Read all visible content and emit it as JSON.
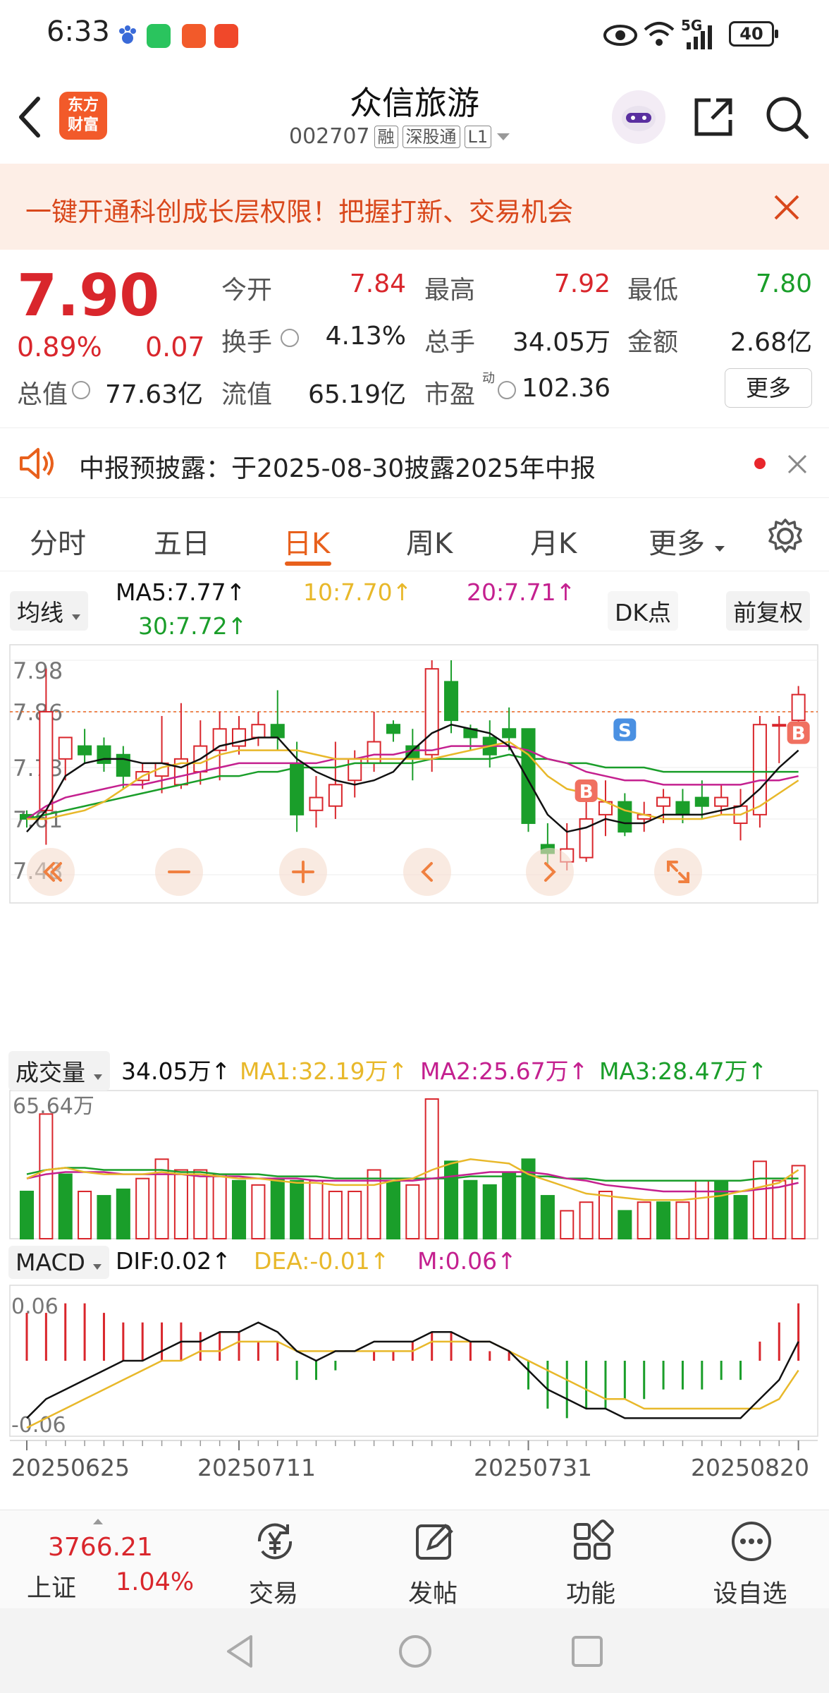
{
  "status_bar": {
    "time": "6:33",
    "network": "5G",
    "battery": "40",
    "icons": [
      "baidu-paw-icon",
      "wechat-icon",
      "app-icon",
      "send-icon",
      "eye-icon",
      "wifi-icon",
      "signal-icon",
      "battery-icon"
    ]
  },
  "header": {
    "brand": "东方财富",
    "title": "众信旅游",
    "code": "002707",
    "tags": [
      "融",
      "深股通",
      "L1"
    ],
    "icons": [
      "back-icon",
      "robot-avatar-icon",
      "share-icon",
      "search-icon"
    ]
  },
  "banner": {
    "text": "一键开通科创成长层权限！把握打新、交易机会",
    "color": "#d9481c"
  },
  "quote": {
    "price": "7.90",
    "change_pct": "0.89%",
    "change": "0.07",
    "rows": [
      [
        {
          "label": "今开",
          "value": "7.84",
          "color": "red"
        },
        {
          "label": "最高",
          "value": "7.92",
          "color": "red"
        },
        {
          "label": "最低",
          "value": "7.80",
          "color": "green"
        }
      ],
      [
        {
          "label": "换手",
          "value": "4.13%",
          "color": "black"
        },
        {
          "label": "总手",
          "value": "34.05万",
          "color": "black"
        },
        {
          "label": "金额",
          "value": "2.68亿",
          "color": "black"
        }
      ],
      [
        {
          "label": "流值",
          "value": "65.19亿",
          "color": "black"
        },
        {
          "label": "市盈",
          "value": "102.36",
          "color": "black"
        }
      ]
    ],
    "total_value_label": "总值",
    "total_value": "77.63亿",
    "pe_tag": "动",
    "more": "更多"
  },
  "notice": {
    "text": "中报预披露：于2025-08-30披露2025年中报",
    "icons": [
      "speaker-icon",
      "red-dot-icon",
      "close-icon"
    ]
  },
  "tabs": [
    "分时",
    "五日",
    "日K",
    "周K",
    "月K",
    "更多"
  ],
  "active_tab": "日K",
  "ma_legend": {
    "selector": "均线",
    "ma5": "MA5:7.77",
    "ma10": "10:7.70",
    "ma20": "20:7.71",
    "ma30": "30:7.72",
    "dk": "DK点",
    "adjust": "前复权"
  },
  "vol_legend": {
    "selector": "成交量",
    "vol": "34.05万",
    "ma1": "MA1:32.19万",
    "ma2": "MA2:25.67万",
    "ma3": "MA3:28.47万"
  },
  "macd_legend": {
    "selector": "MACD",
    "dif": "DIF:0.02",
    "dea": "DEA:-0.01",
    "m": "M:0.06"
  },
  "colors": {
    "up": "#d9262c",
    "down": "#1a9e2a",
    "ma5": "#111111",
    "ma10": "#e8b82a",
    "ma20": "#c4208f",
    "ma30": "#1a9e2a",
    "accent": "#e8601c"
  },
  "chart_data": [
    {
      "type": "candlestick",
      "title": "日K",
      "y_ticks": [
        "7.98",
        "7.86",
        "7.73",
        "7.61",
        "7.48"
      ],
      "ylim": [
        7.48,
        7.98
      ],
      "x_ticks": [
        "20250625",
        "20250711",
        "20250731",
        "20250820"
      ],
      "last_price_line": 7.86,
      "candles": [
        [
          7.62,
          7.61,
          7.63,
          7.59
        ],
        [
          7.63,
          7.86,
          7.96,
          7.55
        ],
        [
          7.75,
          7.8,
          7.8,
          7.7
        ],
        [
          7.78,
          7.76,
          7.82,
          7.74
        ],
        [
          7.78,
          7.74,
          7.8,
          7.72
        ],
        [
          7.76,
          7.71,
          7.78,
          7.68
        ],
        [
          7.7,
          7.72,
          7.74,
          7.68
        ],
        [
          7.71,
          7.74,
          7.85,
          7.67
        ],
        [
          7.69,
          7.75,
          7.88,
          7.68
        ],
        [
          7.72,
          7.78,
          7.84,
          7.69
        ],
        [
          7.77,
          7.82,
          7.86,
          7.7
        ],
        [
          7.78,
          7.82,
          7.85,
          7.76
        ],
        [
          7.8,
          7.83,
          7.86,
          7.78
        ],
        [
          7.83,
          7.8,
          7.91,
          7.77
        ],
        [
          7.74,
          7.62,
          7.79,
          7.58
        ],
        [
          7.63,
          7.66,
          7.71,
          7.59
        ],
        [
          7.64,
          7.69,
          7.79,
          7.61
        ],
        [
          7.7,
          7.75,
          7.77,
          7.66
        ],
        [
          7.74,
          7.79,
          7.86,
          7.72
        ],
        [
          7.83,
          7.81,
          7.84,
          7.79
        ],
        [
          7.78,
          7.75,
          7.82,
          7.7
        ],
        [
          7.76,
          7.96,
          7.98,
          7.72
        ],
        [
          7.93,
          7.84,
          7.98,
          7.81
        ],
        [
          7.82,
          7.8,
          7.83,
          7.77
        ],
        [
          7.8,
          7.76,
          7.84,
          7.73
        ],
        [
          7.82,
          7.8,
          7.87,
          7.77
        ],
        [
          7.82,
          7.6,
          7.82,
          7.58
        ],
        [
          7.55,
          7.53,
          7.6,
          7.5
        ],
        [
          7.51,
          7.54,
          7.6,
          7.49
        ],
        [
          7.52,
          7.61,
          7.65,
          7.51
        ],
        [
          7.62,
          7.65,
          7.7,
          7.57
        ],
        [
          7.65,
          7.58,
          7.67,
          7.57
        ],
        [
          7.61,
          7.62,
          7.65,
          7.58
        ],
        [
          7.64,
          7.66,
          7.68,
          7.6
        ],
        [
          7.65,
          7.62,
          7.68,
          7.6
        ],
        [
          7.66,
          7.64,
          7.7,
          7.61
        ],
        [
          7.64,
          7.66,
          7.69,
          7.62
        ],
        [
          7.6,
          7.64,
          7.68,
          7.56
        ],
        [
          7.62,
          7.83,
          7.85,
          7.59
        ],
        [
          7.83,
          7.83,
          7.85,
          7.74
        ],
        [
          7.84,
          7.9,
          7.92,
          7.8
        ]
      ],
      "ma5": [
        7.58,
        7.63,
        7.71,
        7.74,
        7.75,
        7.75,
        7.74,
        7.74,
        7.73,
        7.75,
        7.78,
        7.79,
        7.8,
        7.8,
        7.75,
        7.72,
        7.7,
        7.69,
        7.7,
        7.72,
        7.77,
        7.81,
        7.83,
        7.82,
        7.81,
        7.78,
        7.7,
        7.62,
        7.58,
        7.59,
        7.61,
        7.6,
        7.6,
        7.62,
        7.62,
        7.62,
        7.63,
        7.64,
        7.68,
        7.73,
        7.77
      ],
      "ma10": [
        7.61,
        7.61,
        7.62,
        7.63,
        7.65,
        7.68,
        7.71,
        7.73,
        7.74,
        7.74,
        7.76,
        7.77,
        7.77,
        7.77,
        7.77,
        7.76,
        7.75,
        7.75,
        7.75,
        7.75,
        7.75,
        7.75,
        7.76,
        7.77,
        7.78,
        7.79,
        7.76,
        7.71,
        7.68,
        7.67,
        7.65,
        7.63,
        7.62,
        7.61,
        7.61,
        7.61,
        7.62,
        7.62,
        7.64,
        7.67,
        7.7
      ],
      "ma20": [
        7.61,
        7.64,
        7.66,
        7.67,
        7.68,
        7.69,
        7.69,
        7.7,
        7.71,
        7.72,
        7.73,
        7.74,
        7.74,
        7.74,
        7.74,
        7.74,
        7.75,
        7.75,
        7.76,
        7.76,
        7.77,
        7.77,
        7.78,
        7.78,
        7.78,
        7.78,
        7.77,
        7.75,
        7.74,
        7.72,
        7.71,
        7.7,
        7.7,
        7.69,
        7.69,
        7.69,
        7.69,
        7.69,
        7.7,
        7.7,
        7.71
      ],
      "ma30": [
        7.61,
        7.62,
        7.63,
        7.64,
        7.65,
        7.66,
        7.67,
        7.68,
        7.69,
        7.7,
        7.71,
        7.71,
        7.72,
        7.72,
        7.73,
        7.73,
        7.73,
        7.74,
        7.74,
        7.74,
        7.74,
        7.75,
        7.75,
        7.75,
        7.75,
        7.76,
        7.75,
        7.75,
        7.74,
        7.74,
        7.73,
        7.73,
        7.73,
        7.72,
        7.72,
        7.72,
        7.72,
        7.72,
        7.72,
        7.72,
        7.72
      ],
      "markers": [
        {
          "label": "S",
          "index": 31
        },
        {
          "label": "B",
          "index": 29
        },
        {
          "label": "B",
          "index": 40
        }
      ]
    },
    {
      "type": "bar",
      "title": "成交量",
      "y_ticks": [
        "65.64万"
      ],
      "ylim": [
        0,
        65.64
      ],
      "values": [
        22,
        58,
        30,
        22,
        20,
        23,
        28,
        37,
        32,
        32,
        30,
        27,
        25,
        28,
        27,
        27,
        22,
        22,
        32,
        27,
        25,
        65,
        36,
        27,
        25,
        31,
        37,
        20,
        13,
        17,
        22,
        13,
        17,
        17,
        17,
        27,
        27,
        20,
        36,
        27,
        34
      ],
      "direction": [
        "d",
        "u",
        "d",
        "u",
        "d",
        "d",
        "u",
        "u",
        "u",
        "u",
        "u",
        "d",
        "u",
        "d",
        "d",
        "u",
        "u",
        "u",
        "u",
        "d",
        "u",
        "u",
        "d",
        "d",
        "d",
        "d",
        "d",
        "d",
        "u",
        "u",
        "u",
        "d",
        "u",
        "d",
        "u",
        "u",
        "d",
        "d",
        "u",
        "u",
        "u"
      ],
      "series": [
        {
          "name": "MA1",
          "values": [
            28,
            32,
            33,
            31,
            30,
            30,
            30,
            31,
            30,
            30,
            29,
            28,
            28,
            27,
            26,
            26,
            25,
            25,
            25,
            27,
            28,
            32,
            35,
            37,
            36,
            35,
            30,
            27,
            24,
            21,
            20,
            19,
            18,
            18,
            18,
            19,
            20,
            22,
            24,
            26,
            32
          ]
        },
        {
          "name": "MA2",
          "values": [
            28,
            30,
            31,
            31,
            31,
            30,
            30,
            30,
            30,
            29,
            29,
            29,
            28,
            28,
            28,
            27,
            27,
            27,
            27,
            27,
            27,
            28,
            29,
            30,
            31,
            31,
            31,
            30,
            28,
            27,
            25,
            24,
            23,
            22,
            22,
            22,
            22,
            22,
            23,
            24,
            26
          ]
        },
        {
          "name": "MA3",
          "values": [
            30,
            32,
            33,
            33,
            32,
            32,
            32,
            32,
            31,
            31,
            30,
            30,
            30,
            29,
            29,
            29,
            28,
            28,
            28,
            28,
            28,
            28,
            28,
            29,
            29,
            29,
            29,
            29,
            28,
            28,
            27,
            27,
            27,
            27,
            27,
            27,
            27,
            27,
            28,
            28,
            28
          ]
        }
      ]
    },
    {
      "type": "macd",
      "title": "MACD",
      "y_ticks": [
        "0.06",
        "-0.06"
      ],
      "ylim": [
        -0.07,
        0.07
      ],
      "histogram": [
        0.05,
        0.05,
        0.06,
        0.06,
        0.05,
        0.04,
        0.04,
        0.04,
        0.04,
        0.03,
        0.03,
        0.03,
        0.02,
        0.02,
        -0.02,
        -0.02,
        -0.01,
        0,
        0.01,
        0.01,
        0.02,
        0.03,
        0.03,
        0.02,
        0.01,
        0.01,
        -0.03,
        -0.05,
        -0.06,
        -0.05,
        -0.05,
        -0.04,
        -0.04,
        -0.03,
        -0.03,
        -0.03,
        -0.02,
        -0.02,
        0.02,
        0.04,
        0.06
      ],
      "dif": [
        -0.06,
        -0.04,
        -0.03,
        -0.02,
        -0.01,
        0,
        0,
        0.01,
        0.02,
        0.02,
        0.03,
        0.03,
        0.04,
        0.03,
        0.01,
        0,
        0.01,
        0.01,
        0.02,
        0.02,
        0.02,
        0.03,
        0.03,
        0.02,
        0.02,
        0.01,
        -0.01,
        -0.03,
        -0.04,
        -0.05,
        -0.05,
        -0.06,
        -0.06,
        -0.06,
        -0.06,
        -0.06,
        -0.06,
        -0.06,
        -0.04,
        -0.02,
        0.02
      ],
      "dea": [
        -0.07,
        -0.06,
        -0.05,
        -0.04,
        -0.03,
        -0.02,
        -0.01,
        0,
        0,
        0.01,
        0.01,
        0.02,
        0.02,
        0.02,
        0.01,
        0.01,
        0.01,
        0.01,
        0.01,
        0.01,
        0.01,
        0.02,
        0.02,
        0.02,
        0.02,
        0.01,
        0,
        -0.01,
        -0.02,
        -0.03,
        -0.04,
        -0.04,
        -0.05,
        -0.05,
        -0.05,
        -0.05,
        -0.05,
        -0.05,
        -0.05,
        -0.04,
        -0.01
      ]
    }
  ],
  "chart_controls": [
    "prev-page-icon",
    "zoom-out-icon",
    "zoom-in-icon",
    "left-icon",
    "right-icon",
    "fullscreen-icon"
  ],
  "bottom_nav": {
    "index_value": "3766.21",
    "index_name": "上证",
    "index_change": "1.04%",
    "items": [
      "交易",
      "发帖",
      "功能",
      "设自选"
    ]
  }
}
